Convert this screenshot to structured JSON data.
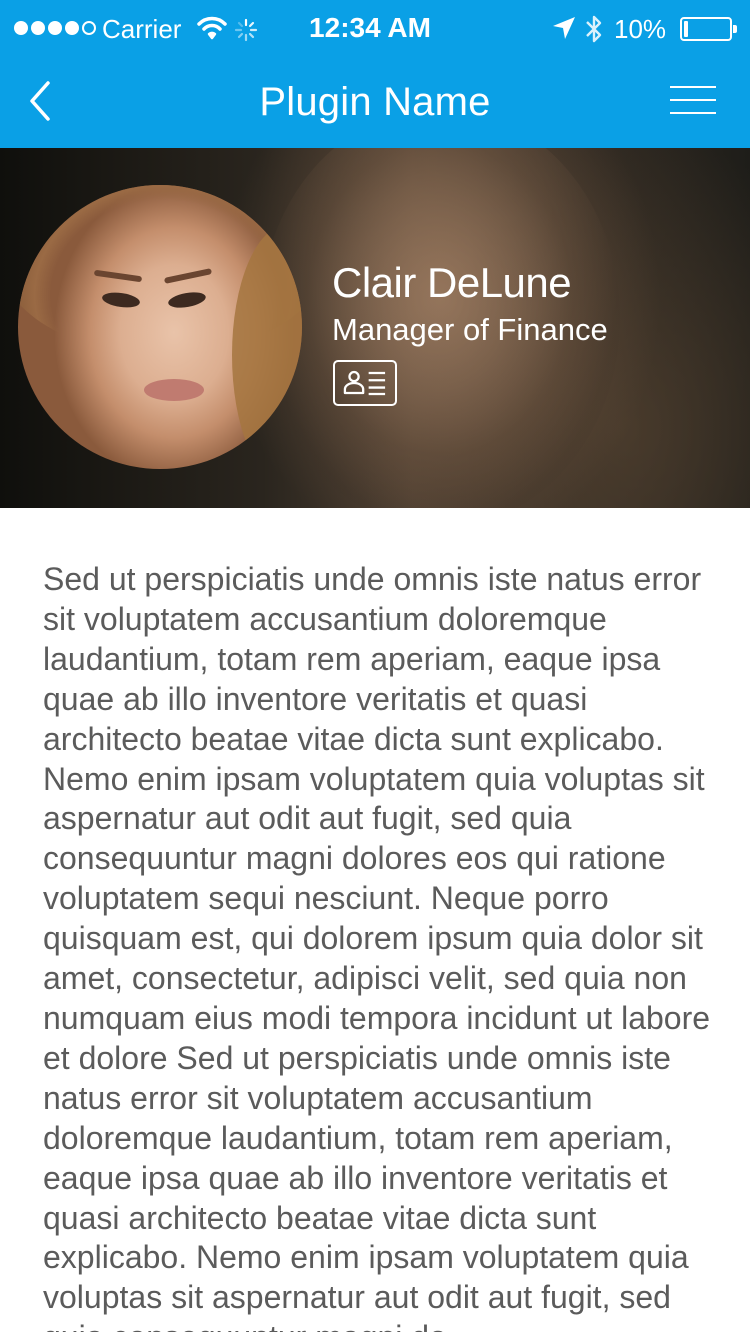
{
  "status_bar": {
    "carrier": "Carrier",
    "time": "12:34 AM",
    "battery_percent": "10%",
    "battery_level": 0.1,
    "signal_bars_filled": 4,
    "signal_bars_total": 5,
    "icons": [
      "wifi-icon",
      "activity-spinner-icon",
      "location-arrow-icon",
      "bluetooth-icon",
      "battery-icon"
    ]
  },
  "nav": {
    "title": "Plugin Name",
    "back_icon": "chevron-left-icon",
    "menu_icon": "hamburger-menu-icon"
  },
  "profile": {
    "name": "Clair DeLune",
    "title": "Manager of Finance",
    "contact_card_icon": "contact-card-icon"
  },
  "body": {
    "text": "Sed ut perspiciatis unde omnis iste natus error sit voluptatem accusantium doloremque laudantium, totam rem aperiam, eaque ipsa quae ab illo inventore veritatis et quasi architecto beatae vitae dicta sunt explicabo. Nemo enim ipsam voluptatem quia voluptas sit aspernatur aut odit aut fugit, sed quia consequuntur magni dolores eos qui ratione voluptatem sequi nesciunt. Neque porro quisquam est, qui dolorem ipsum quia dolor sit amet, consectetur, adipisci velit, sed quia non numquam eius modi tempora incidunt ut labore et dolore Sed ut perspiciatis unde omnis iste natus error sit voluptatem accusantium doloremque laudantium, totam rem aperiam, eaque ipsa quae ab illo inventore veritatis et quasi architecto beatae vitae dicta sunt explicabo. Nemo enim ipsam voluptatem quia voluptas sit aspernatur aut odit aut fugit, sed quia consequuntur magni do"
  },
  "colors": {
    "accent": "#0aa0e6",
    "body_text": "#5b5b5b",
    "header_text": "#ffffff"
  }
}
